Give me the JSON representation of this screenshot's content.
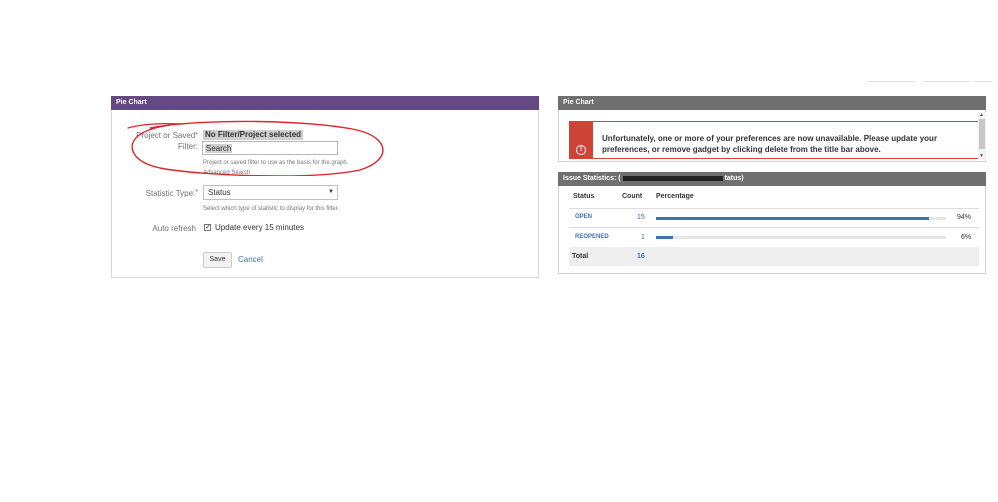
{
  "colors": {
    "left_title_bar": "#654982",
    "right_title_bar": "#707070",
    "error_red": "#d04437",
    "link_blue": "#3b73af",
    "annotation_red": "#e0242b"
  },
  "left_gadget": {
    "title": "Pie Chart",
    "filter_label_line1": "Project or Saved",
    "filter_label_line2": "Filter:",
    "filter_value": "No Filter/Project selected",
    "search_value": "Search",
    "filter_help": "Project or saved filter to use as the basis for the graph.",
    "advanced_search": "Advanced Search",
    "statistic_label": "Statistic Type:",
    "statistic_value": "Status",
    "statistic_help": "Select which type of statistic to display for this filter.",
    "auto_refresh_label": "Auto refresh",
    "auto_refresh_checked": true,
    "auto_refresh_text": "Update every 15 minutes",
    "save": "Save",
    "cancel": "Cancel"
  },
  "right_error_gadget": {
    "title": "Pie Chart",
    "icon": "error-icon",
    "message": "Unfortunately, one or more of your preferences are now unavailable. Please update your preferences, or remove gadget by clicking delete from the title bar above."
  },
  "stats_gadget": {
    "title_prefix": "Issue Statistics: (",
    "title_suffix": "tatus)",
    "headers": {
      "status": "Status",
      "count": "Count",
      "percentage": "Percentage"
    },
    "rows": [
      {
        "status": "OPEN",
        "count": "15",
        "percent": "94%",
        "fraction": 0.94
      },
      {
        "status": "REOPENED",
        "count": "1",
        "percent": "6%",
        "fraction": 0.06
      }
    ],
    "total_label": "Total",
    "total_count": "16"
  }
}
